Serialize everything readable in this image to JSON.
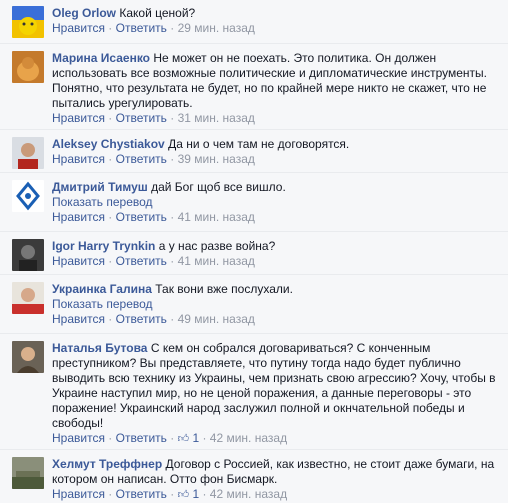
{
  "actions": {
    "like": "Нравится",
    "reply": "Ответить",
    "translate": "Показать перевод",
    "dot": " · "
  },
  "comments": [
    {
      "author": "Oleg Orlow",
      "text": "Какой ценой?",
      "time": "29 мин. назад"
    },
    {
      "author": "Марина Исаенко",
      "text": "Не может он не поехать. Это политика. Он должен использовать все возможные политические и дипломатические инструменты. Понятно, что результата не будет, но по крайней мере никто не скажет, что не пытались урегулировать.",
      "time": "31 мин. назад"
    },
    {
      "author": "Aleksey Chystiakov",
      "text": "Да ни о чем там не договорятся.",
      "time": "39 мин. назад"
    },
    {
      "author": "Дмитрий Тимуш",
      "text": "дай Бог щоб все вишло.",
      "time": "41 мин. назад"
    },
    {
      "author": "Igor Harry Trynkin",
      "text": "а у нас разве война?",
      "time": "41 мин. назад"
    },
    {
      "author": "Украинка Галина",
      "text": "Так вони вже послухали.",
      "time": "49 мин. назад"
    },
    {
      "author": "Наталья Бутова",
      "text": "С кем он собрался договариваться? С конченным преступником? Вы представляете, что путину тогда надо будет публично выводить всю технику из Украины, чем признать свою агрессию? Хочу, чтобы в Украине наступил мир, но не ценой поражения, а данные переговоры - это поражение! Украинский народ заслужил полной и окнчательной победы и свободы!",
      "time": "42 мин. назад",
      "likes": "1"
    },
    {
      "author": "Хелмут Треффнер",
      "text": "Договор с Россией, как известно, не стоит даже бумаги, на котором он написан. Отто фон Бисмарк.",
      "time": "42 мин. назад",
      "likes": "1"
    }
  ]
}
